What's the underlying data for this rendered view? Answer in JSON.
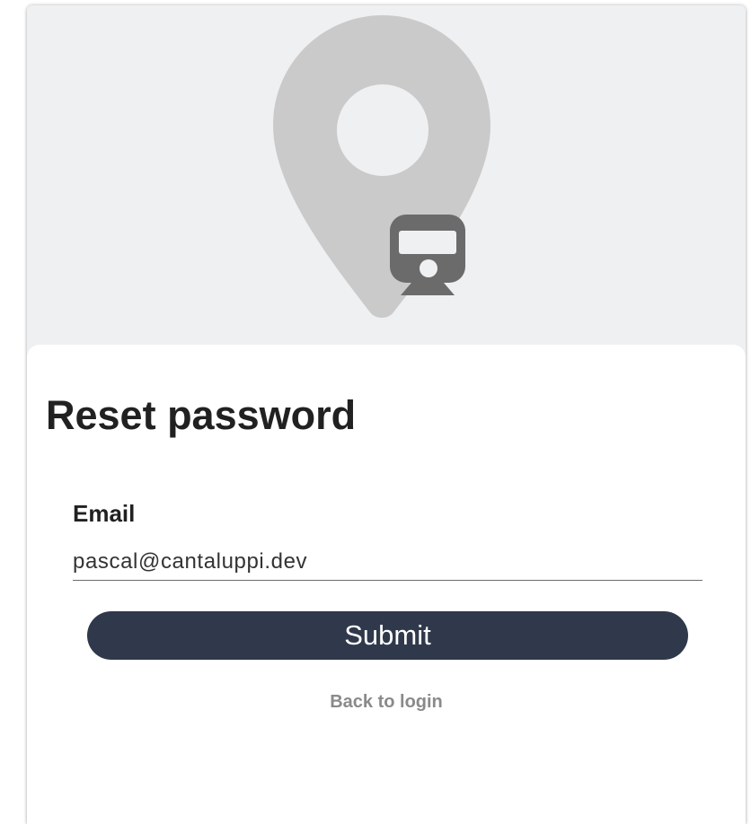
{
  "reset_form": {
    "title": "Reset password",
    "email_label": "Email",
    "email_value": "pascal@cantaluppi.dev",
    "submit_label": "Submit",
    "back_link_label": "Back to login"
  },
  "colors": {
    "hero_background": "#eff0f2",
    "pin_color": "#cacaca",
    "train_icon_color": "#6b6b6b",
    "submit_background": "#30394b",
    "link_color": "#8a8a8a"
  },
  "icons": {
    "hero_pin": "map-pin-icon",
    "hero_train": "train-icon"
  }
}
